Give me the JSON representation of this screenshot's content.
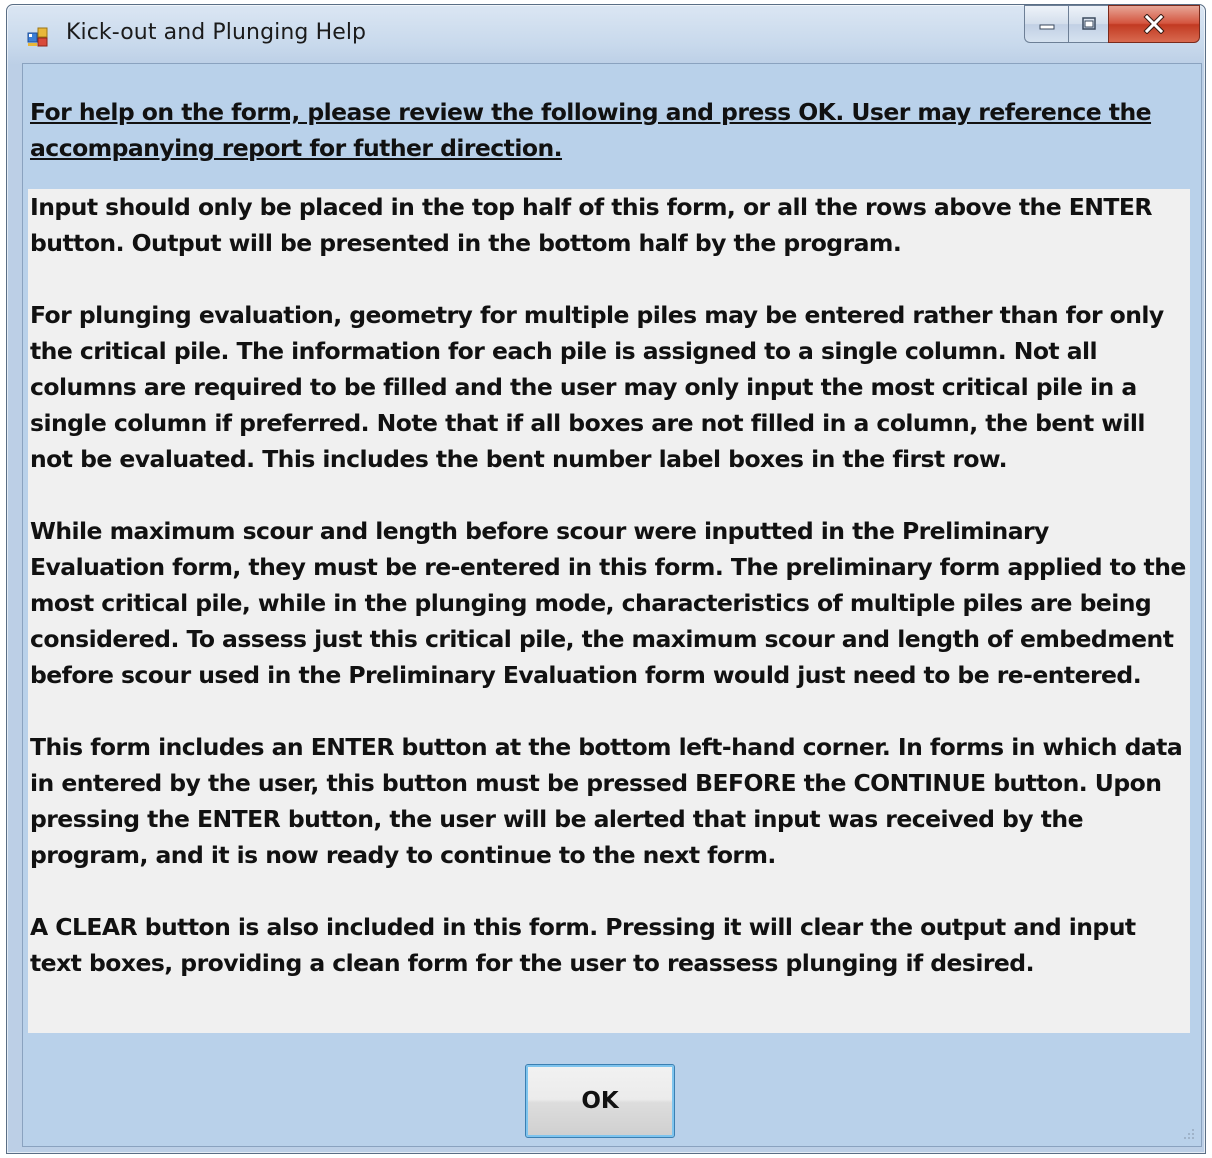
{
  "window": {
    "title": "Kick-out and Plunging Help",
    "icon": "app-icon",
    "controls": [
      "minimize-icon",
      "maximize-icon",
      "close-icon"
    ]
  },
  "content": {
    "header": "For help on the form, please review the following and press OK.  User may reference the accompanying report for futher direction.",
    "paragraphs": [
      "Input should only be placed in the top half of this form, or all the rows above the ENTER button.  Output will be presented in the bottom half by the program.",
      "For plunging evaluation, geometry for multiple piles may be entered rather than for only the critical pile.  The information for each pile is assigned to a single column.  Not all columns are required to be filled and the user may only input the most critical pile in a single column if preferred.  Note that if all boxes are not filled in a column, the bent will not be evaluated.  This includes the bent number label boxes in the first row.",
      "While maximum scour and length before scour were inputted in the Preliminary Evaluation form, they must be re-entered in this form.  The preliminary form applied to the most critical pile, while in the plunging mode, characteristics of multiple piles are being considered.  To assess just this critical pile, the maximum scour and length of embedment before scour used in the Preliminary Evaluation form would just need to be re-entered.",
      "This form includes an ENTER button at the bottom left-hand corner.  In forms in which data in entered by the user, this button must be pressed BEFORE the CONTINUE button.  Upon pressing the ENTER button, the user will be alerted that input was received by the program, and it is now ready to continue to the next form.",
      "A CLEAR button is also included in this form.  Pressing it will clear the output and input text boxes, providing a clean form for the user to reassess plunging if desired."
    ]
  },
  "buttons": {
    "ok_label": "OK"
  },
  "colors": {
    "client_background": "#b9d1ea",
    "panel_background": "#f0f0f0",
    "close_button": "#c8432c"
  }
}
